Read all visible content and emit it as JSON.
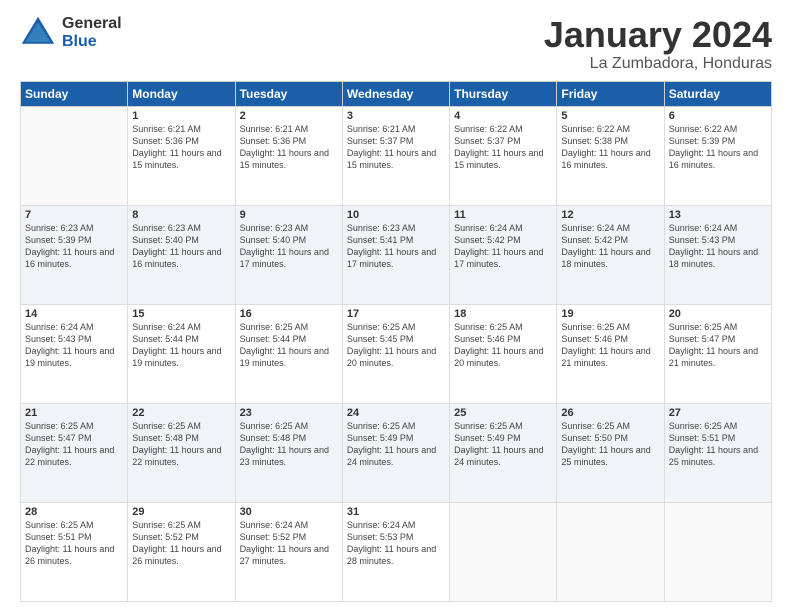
{
  "logo": {
    "general": "General",
    "blue": "Blue"
  },
  "title": "January 2024",
  "location": "La Zumbadora, Honduras",
  "headers": [
    "Sunday",
    "Monday",
    "Tuesday",
    "Wednesday",
    "Thursday",
    "Friday",
    "Saturday"
  ],
  "weeks": [
    [
      {
        "num": "",
        "sunrise": "",
        "sunset": "",
        "daylight": "",
        "empty": true
      },
      {
        "num": "1",
        "sunrise": "Sunrise: 6:21 AM",
        "sunset": "Sunset: 5:36 PM",
        "daylight": "Daylight: 11 hours and 15 minutes."
      },
      {
        "num": "2",
        "sunrise": "Sunrise: 6:21 AM",
        "sunset": "Sunset: 5:36 PM",
        "daylight": "Daylight: 11 hours and 15 minutes."
      },
      {
        "num": "3",
        "sunrise": "Sunrise: 6:21 AM",
        "sunset": "Sunset: 5:37 PM",
        "daylight": "Daylight: 11 hours and 15 minutes."
      },
      {
        "num": "4",
        "sunrise": "Sunrise: 6:22 AM",
        "sunset": "Sunset: 5:37 PM",
        "daylight": "Daylight: 11 hours and 15 minutes."
      },
      {
        "num": "5",
        "sunrise": "Sunrise: 6:22 AM",
        "sunset": "Sunset: 5:38 PM",
        "daylight": "Daylight: 11 hours and 16 minutes."
      },
      {
        "num": "6",
        "sunrise": "Sunrise: 6:22 AM",
        "sunset": "Sunset: 5:39 PM",
        "daylight": "Daylight: 11 hours and 16 minutes."
      }
    ],
    [
      {
        "num": "7",
        "sunrise": "Sunrise: 6:23 AM",
        "sunset": "Sunset: 5:39 PM",
        "daylight": "Daylight: 11 hours and 16 minutes."
      },
      {
        "num": "8",
        "sunrise": "Sunrise: 6:23 AM",
        "sunset": "Sunset: 5:40 PM",
        "daylight": "Daylight: 11 hours and 16 minutes."
      },
      {
        "num": "9",
        "sunrise": "Sunrise: 6:23 AM",
        "sunset": "Sunset: 5:40 PM",
        "daylight": "Daylight: 11 hours and 17 minutes."
      },
      {
        "num": "10",
        "sunrise": "Sunrise: 6:23 AM",
        "sunset": "Sunset: 5:41 PM",
        "daylight": "Daylight: 11 hours and 17 minutes."
      },
      {
        "num": "11",
        "sunrise": "Sunrise: 6:24 AM",
        "sunset": "Sunset: 5:42 PM",
        "daylight": "Daylight: 11 hours and 17 minutes."
      },
      {
        "num": "12",
        "sunrise": "Sunrise: 6:24 AM",
        "sunset": "Sunset: 5:42 PM",
        "daylight": "Daylight: 11 hours and 18 minutes."
      },
      {
        "num": "13",
        "sunrise": "Sunrise: 6:24 AM",
        "sunset": "Sunset: 5:43 PM",
        "daylight": "Daylight: 11 hours and 18 minutes."
      }
    ],
    [
      {
        "num": "14",
        "sunrise": "Sunrise: 6:24 AM",
        "sunset": "Sunset: 5:43 PM",
        "daylight": "Daylight: 11 hours and 19 minutes."
      },
      {
        "num": "15",
        "sunrise": "Sunrise: 6:24 AM",
        "sunset": "Sunset: 5:44 PM",
        "daylight": "Daylight: 11 hours and 19 minutes."
      },
      {
        "num": "16",
        "sunrise": "Sunrise: 6:25 AM",
        "sunset": "Sunset: 5:44 PM",
        "daylight": "Daylight: 11 hours and 19 minutes."
      },
      {
        "num": "17",
        "sunrise": "Sunrise: 6:25 AM",
        "sunset": "Sunset: 5:45 PM",
        "daylight": "Daylight: 11 hours and 20 minutes."
      },
      {
        "num": "18",
        "sunrise": "Sunrise: 6:25 AM",
        "sunset": "Sunset: 5:46 PM",
        "daylight": "Daylight: 11 hours and 20 minutes."
      },
      {
        "num": "19",
        "sunrise": "Sunrise: 6:25 AM",
        "sunset": "Sunset: 5:46 PM",
        "daylight": "Daylight: 11 hours and 21 minutes."
      },
      {
        "num": "20",
        "sunrise": "Sunrise: 6:25 AM",
        "sunset": "Sunset: 5:47 PM",
        "daylight": "Daylight: 11 hours and 21 minutes."
      }
    ],
    [
      {
        "num": "21",
        "sunrise": "Sunrise: 6:25 AM",
        "sunset": "Sunset: 5:47 PM",
        "daylight": "Daylight: 11 hours and 22 minutes."
      },
      {
        "num": "22",
        "sunrise": "Sunrise: 6:25 AM",
        "sunset": "Sunset: 5:48 PM",
        "daylight": "Daylight: 11 hours and 22 minutes."
      },
      {
        "num": "23",
        "sunrise": "Sunrise: 6:25 AM",
        "sunset": "Sunset: 5:48 PM",
        "daylight": "Daylight: 11 hours and 23 minutes."
      },
      {
        "num": "24",
        "sunrise": "Sunrise: 6:25 AM",
        "sunset": "Sunset: 5:49 PM",
        "daylight": "Daylight: 11 hours and 24 minutes."
      },
      {
        "num": "25",
        "sunrise": "Sunrise: 6:25 AM",
        "sunset": "Sunset: 5:49 PM",
        "daylight": "Daylight: 11 hours and 24 minutes."
      },
      {
        "num": "26",
        "sunrise": "Sunrise: 6:25 AM",
        "sunset": "Sunset: 5:50 PM",
        "daylight": "Daylight: 11 hours and 25 minutes."
      },
      {
        "num": "27",
        "sunrise": "Sunrise: 6:25 AM",
        "sunset": "Sunset: 5:51 PM",
        "daylight": "Daylight: 11 hours and 25 minutes."
      }
    ],
    [
      {
        "num": "28",
        "sunrise": "Sunrise: 6:25 AM",
        "sunset": "Sunset: 5:51 PM",
        "daylight": "Daylight: 11 hours and 26 minutes."
      },
      {
        "num": "29",
        "sunrise": "Sunrise: 6:25 AM",
        "sunset": "Sunset: 5:52 PM",
        "daylight": "Daylight: 11 hours and 26 minutes."
      },
      {
        "num": "30",
        "sunrise": "Sunrise: 6:24 AM",
        "sunset": "Sunset: 5:52 PM",
        "daylight": "Daylight: 11 hours and 27 minutes."
      },
      {
        "num": "31",
        "sunrise": "Sunrise: 6:24 AM",
        "sunset": "Sunset: 5:53 PM",
        "daylight": "Daylight: 11 hours and 28 minutes."
      },
      {
        "num": "",
        "sunrise": "",
        "sunset": "",
        "daylight": "",
        "empty": true
      },
      {
        "num": "",
        "sunrise": "",
        "sunset": "",
        "daylight": "",
        "empty": true
      },
      {
        "num": "",
        "sunrise": "",
        "sunset": "",
        "daylight": "",
        "empty": true
      }
    ]
  ]
}
